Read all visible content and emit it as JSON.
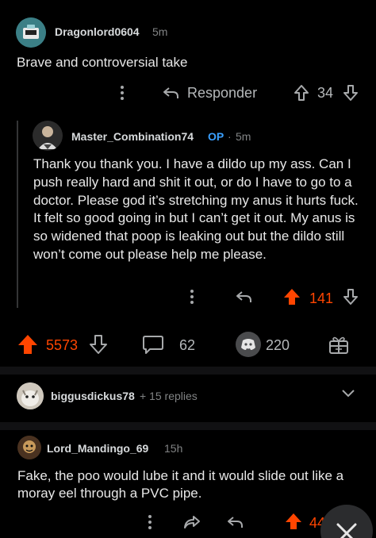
{
  "comment1": {
    "username": "Dragonlord0604",
    "time": "5m",
    "body": "Brave and controversial take",
    "reply_label": "Responder",
    "votes": "34"
  },
  "comment2": {
    "username": "Master_Combination74",
    "op_badge": "OP",
    "time": "5m",
    "body": "Thank you thank you. I have a dildo up my ass. Can I push really hard and shit it out, or do I have to go to a doctor. Please god it’s stretching my anus it hurts fuck. It felt so good going in but I can’t get it out. My anus is so widened that poop is leaking out but the dildo still won’t come out please help me please.",
    "votes": "141"
  },
  "post_bar": {
    "votes": "5573",
    "comments": "62",
    "awards": "220"
  },
  "collapsed_thread": {
    "username": "biggusdickus78",
    "replies": "+ 15 replies"
  },
  "comment3": {
    "username": "Lord_Mandingo_69",
    "time": "15h",
    "body": "Fake, the poo would lube it and it would slide out like a moray eel through a PVC pipe.",
    "votes": "44"
  },
  "colors": {
    "accent": "#ff4500",
    "op_blue": "#3aa0ff",
    "background": "#000000",
    "text": "#e8e8e8"
  }
}
